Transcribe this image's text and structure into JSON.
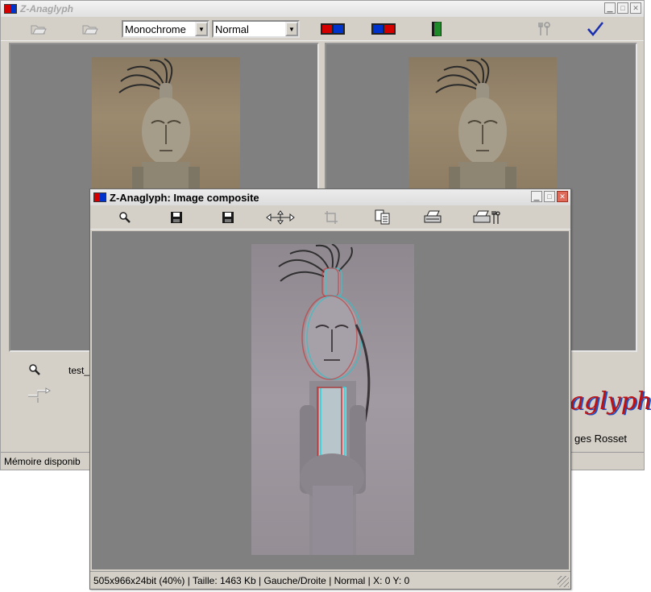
{
  "main": {
    "title": "Z-Anaglyph",
    "toolbar": {
      "open_left_icon": "folder-open-icon",
      "open_right_icon": "folder-open-icon",
      "mode_select": "Monochrome",
      "filter_select": "Normal",
      "settings_icon": "tools-icon",
      "ok_icon": "checkmark-icon"
    },
    "left_file": "test_",
    "status": "Mémoire disponib",
    "logo_text": "aglyph",
    "credit_text": "ges Rosset"
  },
  "composite": {
    "title": "Z-Anaglyph: Image composite",
    "toolbar_icons": [
      "zoom-icon",
      "save-icon",
      "save-as-icon",
      "move-icon",
      "crop-icon",
      "copy-icon",
      "print-icon",
      "print-setup-icon"
    ],
    "status": "505x966x24bit (40%) | Taille:  1463 Kb | Gauche/Droite | Normal | X: 0  Y: 0"
  },
  "colors": {
    "window_bg": "#d4d0c8",
    "canvas_bg": "#808080",
    "anaglyph_red": "#d40000",
    "anaglyph_blue": "#0033cc",
    "logo_red": "#c01010"
  }
}
